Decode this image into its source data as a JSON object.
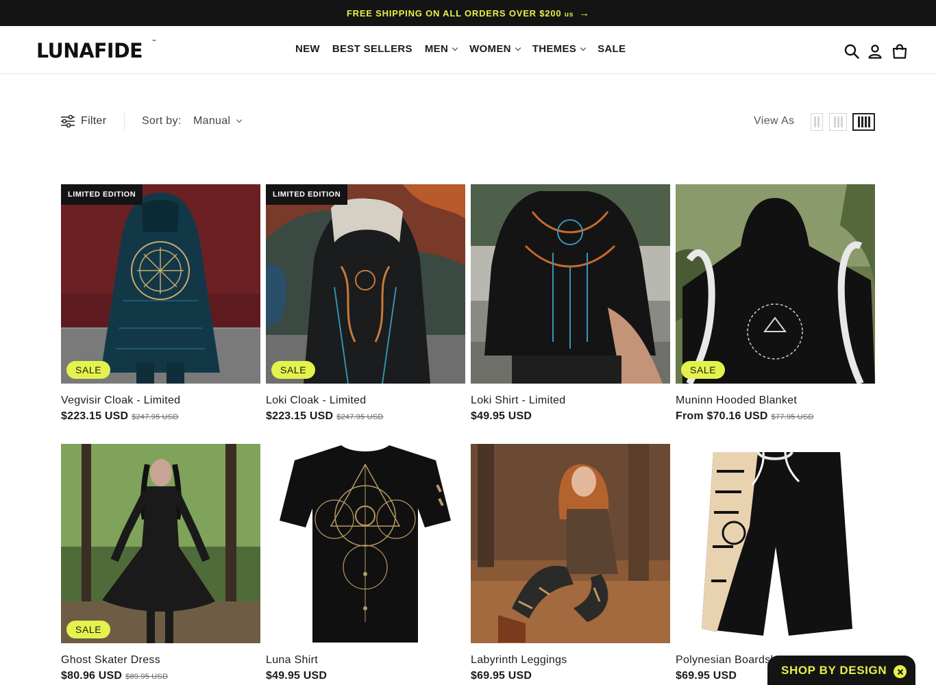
{
  "announcement": {
    "text": "FREE SHIPPING ON ALL ORDERS OVER $200",
    "unit": "us",
    "arrow": "→"
  },
  "header": {
    "logo": "LUNAFIDE",
    "logo_mark": "™",
    "nav": [
      {
        "label": "NEW",
        "has_dropdown": false
      },
      {
        "label": "BEST SELLERS",
        "has_dropdown": false
      },
      {
        "label": "MEN",
        "has_dropdown": true
      },
      {
        "label": "WOMEN",
        "has_dropdown": true
      },
      {
        "label": "THEMES",
        "has_dropdown": true
      },
      {
        "label": "SALE",
        "has_dropdown": false
      }
    ],
    "icons": [
      "search-icon",
      "account-icon",
      "cart-icon"
    ]
  },
  "toolbar": {
    "filter_label": "Filter",
    "sort_label": "Sort by:",
    "sort_value": "Manual",
    "view_label": "View As",
    "view_options": [
      "two-column",
      "three-column",
      "four-column"
    ],
    "active_view": "four-column"
  },
  "products": [
    {
      "title": "Vegvisir Cloak - Limited",
      "price": "$223.15 USD",
      "compare_price": "$247.95 USD",
      "badge_top": "LIMITED EDITION",
      "badge_sale": "SALE"
    },
    {
      "title": "Loki Cloak - Limited",
      "price": "$223.15 USD",
      "compare_price": "$247.95 USD",
      "badge_top": "LIMITED EDITION",
      "badge_sale": "SALE"
    },
    {
      "title": "Loki Shirt - Limited",
      "price": "$49.95 USD",
      "compare_price": "",
      "badge_top": "",
      "badge_sale": ""
    },
    {
      "title": "Muninn Hooded Blanket",
      "price": "From $70.16 USD",
      "compare_price": "$77.95 USD",
      "badge_top": "",
      "badge_sale": "SALE"
    },
    {
      "title": "Ghost Skater Dress",
      "price": "$80.96 USD",
      "compare_price": "$89.95 USD",
      "badge_top": "",
      "badge_sale": "SALE"
    },
    {
      "title": "Luna Shirt",
      "price": "$49.95 USD",
      "compare_price": "",
      "badge_top": "",
      "badge_sale": ""
    },
    {
      "title": "Labyrinth Leggings",
      "price": "$69.95 USD",
      "compare_price": "",
      "badge_top": "",
      "badge_sale": ""
    },
    {
      "title": "Polynesian Boardshorts",
      "price": "$69.95 USD",
      "compare_price": "",
      "badge_top": "",
      "badge_sale": ""
    }
  ],
  "widget": {
    "label": "SHOP BY DESIGN",
    "close_icon": "close-icon"
  },
  "colors": {
    "announcement_bg": "#141414",
    "accent": "#e6f14a",
    "sale_badge": "#e4f24d"
  }
}
